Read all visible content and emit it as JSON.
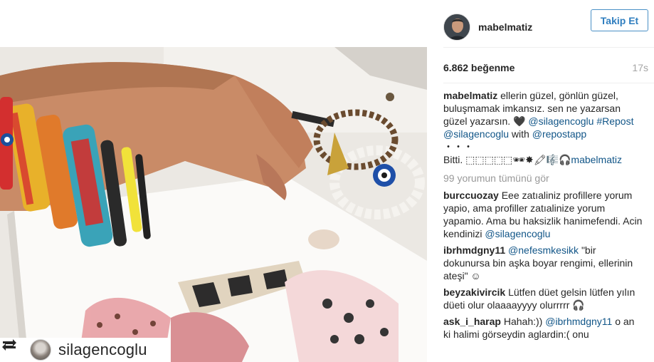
{
  "post": {
    "username": "mabelmatiz",
    "follow_label": "Takip Et",
    "likes": "6.862 beğenme",
    "time": "17s",
    "view_all": "99 yorumun tümünü gör",
    "repost_username": "silagencoglu"
  },
  "caption": {
    "user": "mabelmatiz",
    "text1": "ellerin güzel, gönlün güzel, buluşmamak imkansız. sen ne yazarsan güzel yazarsın. 🖤 ",
    "mention1": "@silagencoglu",
    "tag": "#Repost",
    "mention2": "@silagencoglu",
    "with": " with ",
    "mention3": "@repostapp",
    "dots": "・・・",
    "text2": "Bitti. ",
    "emoji": "⬚⬚⬚⬚⬚🕶✸🖍🎼🎧",
    "mention4": "mabelmatiz"
  },
  "comments": [
    {
      "user": "burccuozay",
      "text": "Eee zatıaliniz profillere yorum yapio, ama profiller zatıalinize yorum yapamio. Ama bu haksizlik hanimefendi. Acin kendinizi ",
      "mention": "@silagencoglu",
      "after": ""
    },
    {
      "user": "ibrhmdgny11",
      "text": "",
      "mention": "@nefesmkesikk",
      "after": " \"bir dokunursa bin aşka boyar rengimi, ellerinin ateşi\" ☺"
    },
    {
      "user": "beyzakivircik",
      "text": "Lütfen düet gelsin lütfen yılın düeti olur olaaaayyyy olurrrrr 🎧",
      "mention": "",
      "after": ""
    },
    {
      "user": "ask_i_harap",
      "text": "Hahah:)) ",
      "mention": "@ibrhmdgny11",
      "after": " o an ki halimi görseydin aglardin:( onu"
    }
  ],
  "colors": {
    "follow_blue": "#2f7ebf",
    "link_blue": "#125688",
    "muted_grey": "#999999"
  }
}
